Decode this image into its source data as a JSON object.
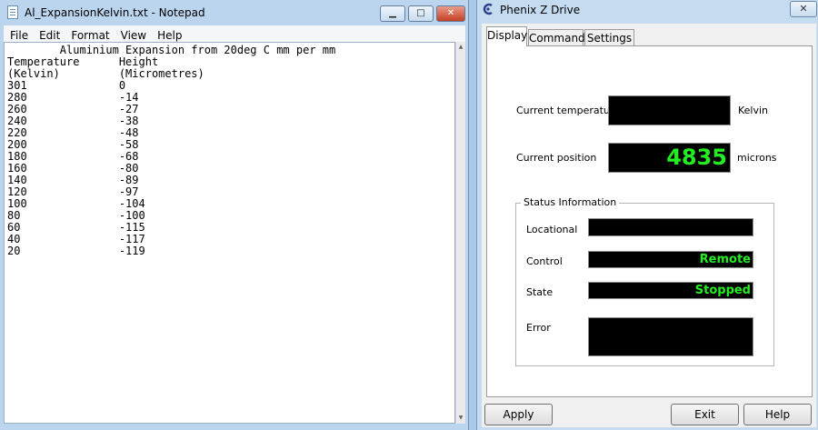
{
  "notepad": {
    "title": "Al_ExpansionKelvin.txt - Notepad",
    "controls": {
      "minimize": "▁",
      "maximize": "□",
      "close": "✕"
    },
    "menu": [
      "File",
      "Edit",
      "Format",
      "View",
      "Help"
    ],
    "content": "        Aluminium Expansion from 20deg C mm per mm\nTemperature      Height\n(Kelvin)         (Micrometres)\n301              0\n280              -14\n260              -27\n240              -38\n220              -48\n200              -58\n180              -68\n160              -80\n140              -89\n120              -97\n100              -104\n80               -100\n60               -115\n40               -117\n20               -119"
  },
  "phenix": {
    "title": "Phenix Z Drive",
    "close": "✕",
    "tabs": [
      "Display",
      "Commands",
      "Settings"
    ],
    "current_temperature_label": "Current temperature",
    "current_temperature_value": "",
    "temperature_unit": "Kelvin",
    "current_position_label": "Current position",
    "current_position_value": "4835",
    "position_unit": "microns",
    "status": {
      "title": "Status Information",
      "locational_label": "Locational",
      "locational_value": "",
      "control_label": "Control",
      "control_value": "Remote",
      "state_label": "State",
      "state_value": "Stopped",
      "error_label": "Error",
      "error_value": ""
    },
    "buttons": {
      "apply": "Apply",
      "exit": "Exit",
      "help": "Help"
    },
    "colors": {
      "lcd_background": "#000000",
      "lcd_text": "#22ee22"
    }
  }
}
